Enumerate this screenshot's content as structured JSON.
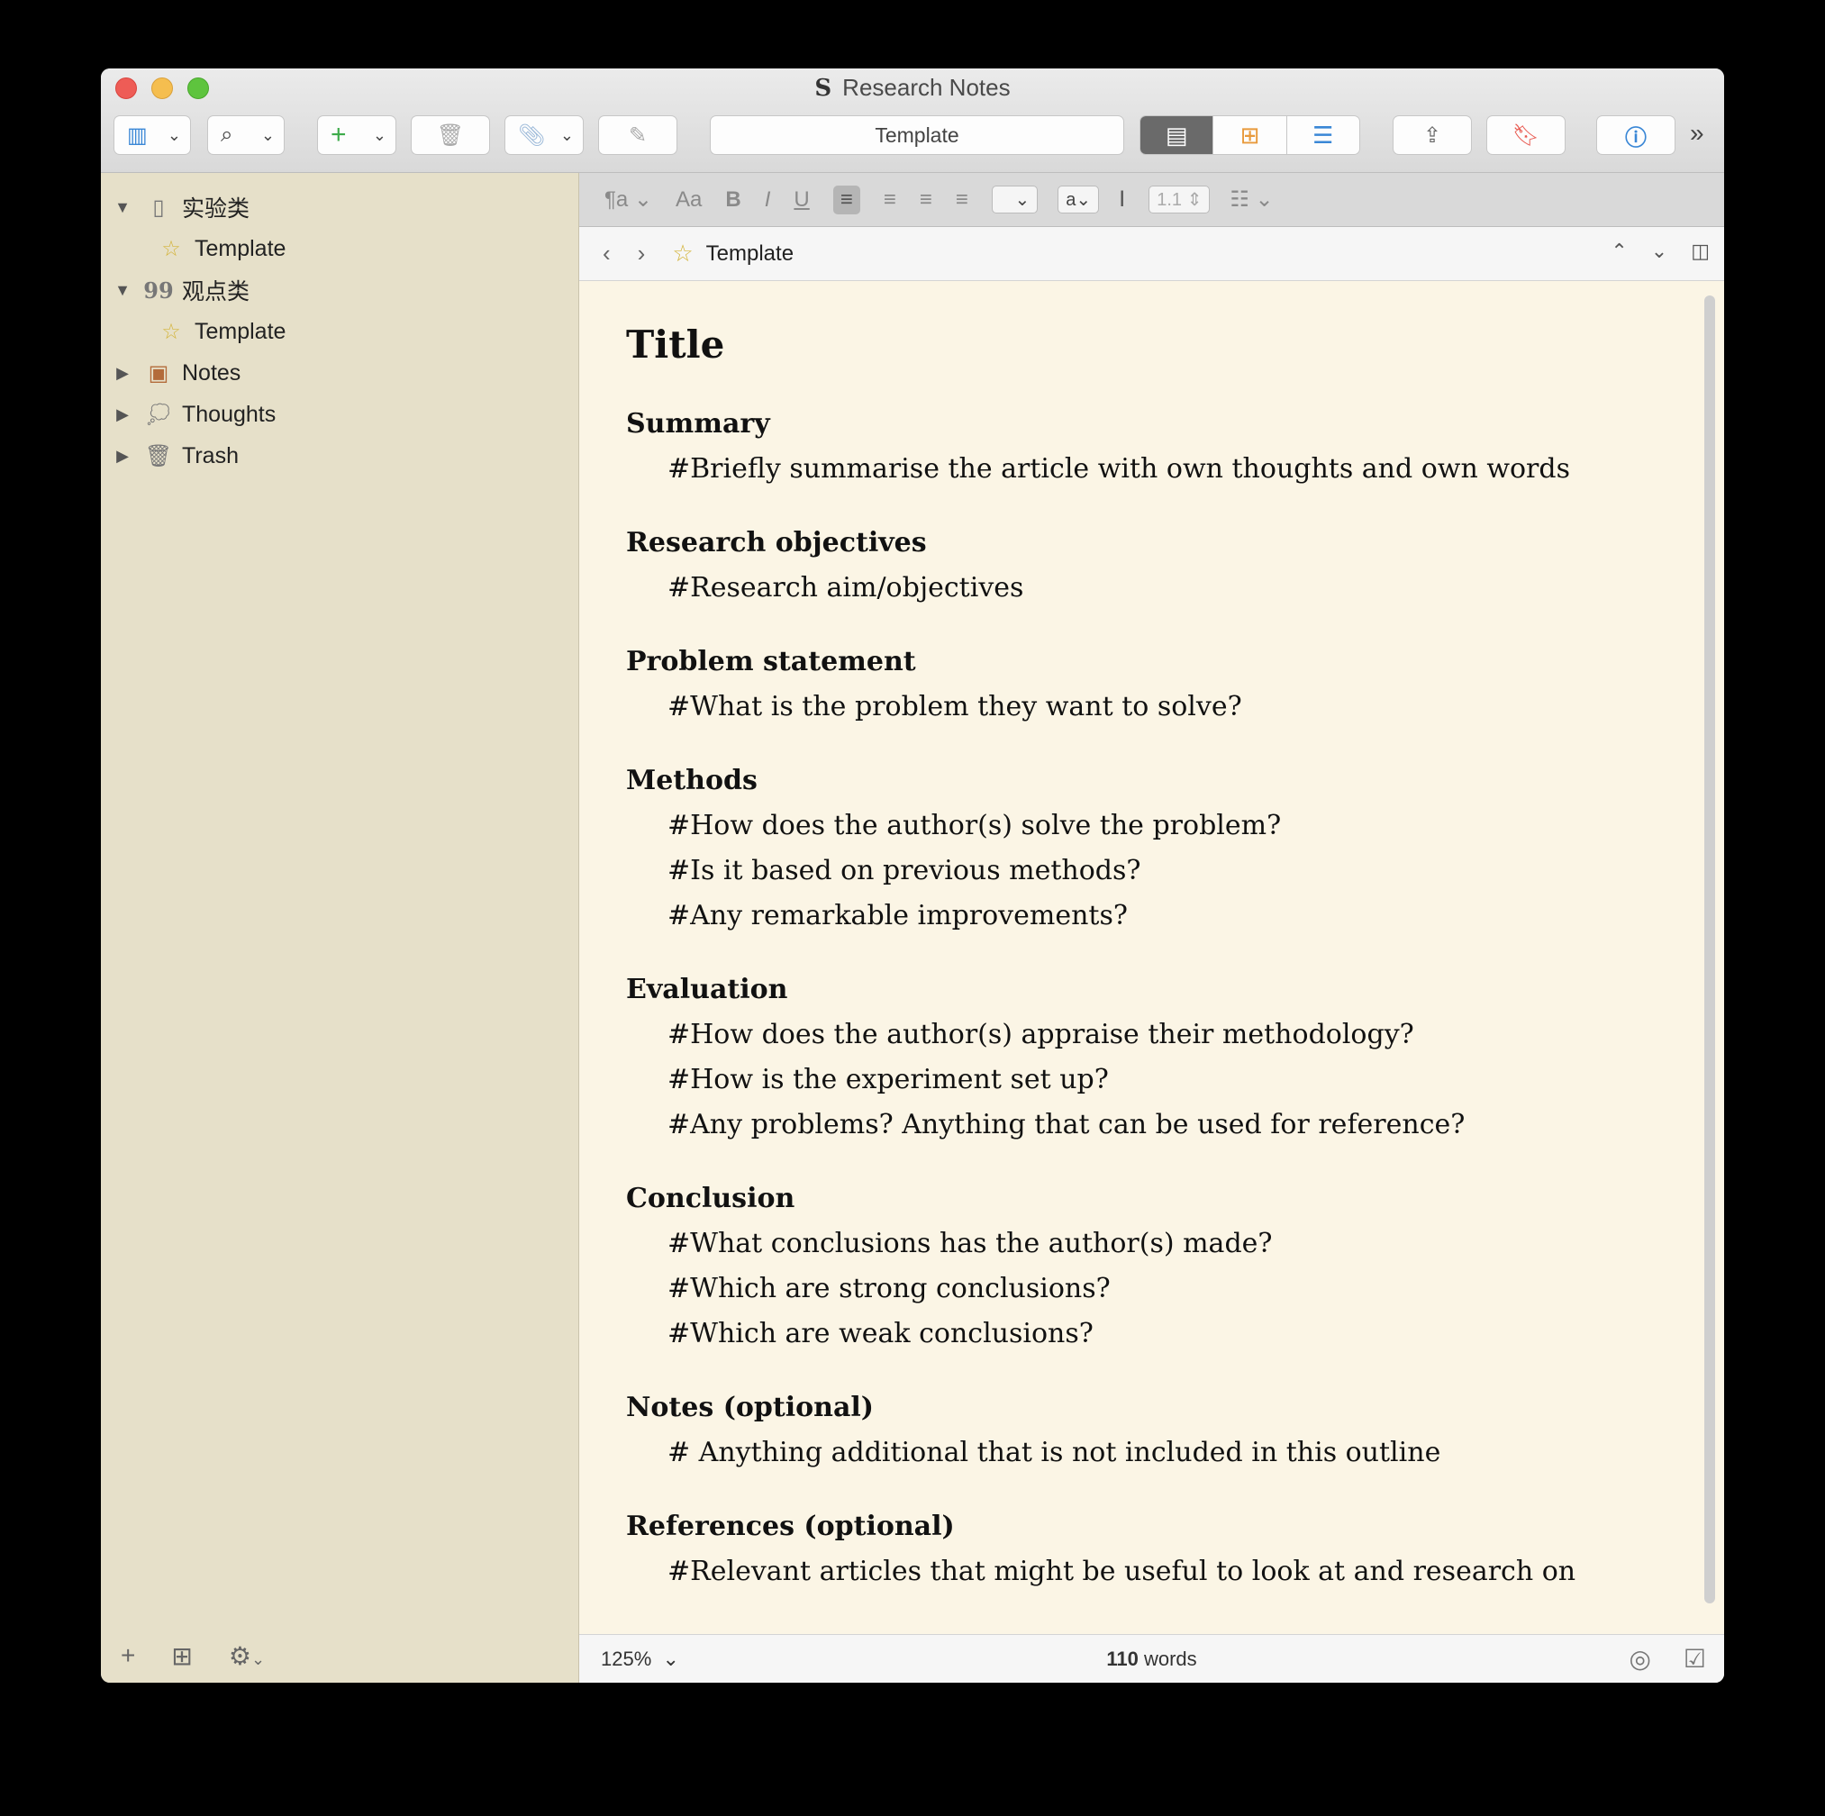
{
  "window": {
    "title": "Research Notes"
  },
  "toolbar": {
    "template_label": "Template"
  },
  "sidebar": {
    "items": [
      {
        "label": "实验类",
        "icon": "document-icon"
      },
      {
        "label": "Template",
        "icon": "star-icon"
      },
      {
        "label": "观点类",
        "icon": "quote-icon"
      },
      {
        "label": "Template",
        "icon": "star-icon"
      },
      {
        "label": "Notes",
        "icon": "notebook-icon"
      },
      {
        "label": "Thoughts",
        "icon": "thought-bubble-icon"
      },
      {
        "label": "Trash",
        "icon": "trash-icon"
      }
    ]
  },
  "formatbar": {
    "line_spacing": "1.1",
    "style_a": "a"
  },
  "navbar": {
    "title": "Template"
  },
  "document": {
    "title": "Title",
    "sections": [
      {
        "heading": "Summary",
        "lines": [
          "#Briefly summarise the article with own thoughts and own words"
        ]
      },
      {
        "heading": "Research objectives",
        "lines": [
          "#Research aim/objectives"
        ]
      },
      {
        "heading": "Problem statement",
        "lines": [
          "#What is the problem they want to solve?"
        ]
      },
      {
        "heading": "Methods",
        "lines": [
          "#How does the author(s) solve the problem?",
          "#Is it based on previous methods?",
          "#Any remarkable improvements?"
        ]
      },
      {
        "heading": "Evaluation",
        "lines": [
          "#How does the author(s) appraise their methodology?",
          "#How is the experiment set up?",
          "#Any problems? Anything that can be used for reference?"
        ]
      },
      {
        "heading": "Conclusion",
        "lines": [
          "#What conclusions has the author(s) made?",
          "#Which are strong conclusions?",
          "#Which are weak conclusions?"
        ]
      },
      {
        "heading": "Notes (optional)",
        "lines": [
          "# Anything additional that is not included in this outline"
        ]
      },
      {
        "heading": "References (optional)",
        "lines": [
          "#Relevant articles that might be useful to look at and research on"
        ]
      }
    ]
  },
  "statusbar": {
    "zoom": "125%",
    "word_count": "110",
    "word_label": "words"
  }
}
